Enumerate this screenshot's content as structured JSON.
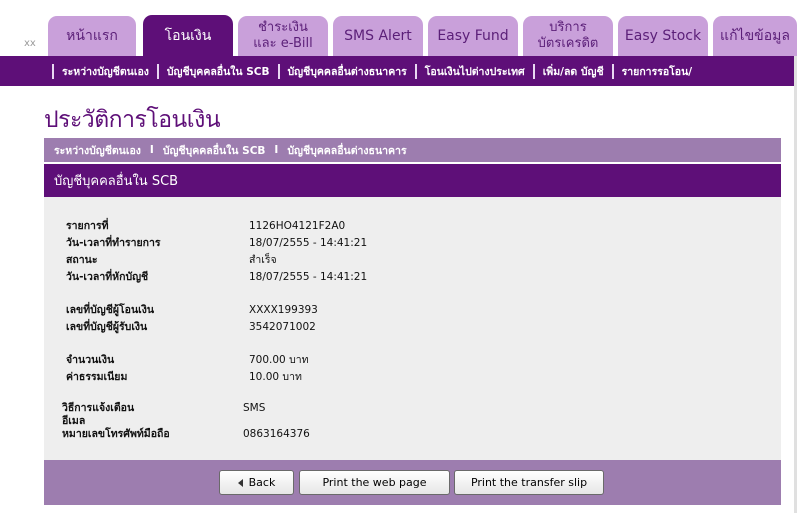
{
  "header": {
    "corner_text": "xx",
    "tabs": [
      {
        "label": "หน้าแรก"
      },
      {
        "label": "โอนเงิน"
      },
      {
        "label_line1": "ชำระเงิน",
        "label_line2": "และ e-Bill"
      },
      {
        "label": "SMS Alert"
      },
      {
        "label": "Easy Fund"
      },
      {
        "label_line1": "บริการ",
        "label_line2": "บัตรเครดิต"
      },
      {
        "label": "Easy Stock"
      },
      {
        "label": "แก้ไขข้อมูล"
      }
    ]
  },
  "subnav": {
    "items": [
      "ระหว่างบัญชีตนเอง",
      "บัญชีบุคคลอื่นใน SCB",
      "บัญชีบุคคลอื่นต่างธนาคาร",
      "โอนเงินไปต่างประเทศ",
      "เพิ่ม/ลด บัญชี",
      "รายการรอโอน/"
    ]
  },
  "page": {
    "title": "ประวัติการโอนเงิน"
  },
  "breadcrumb": {
    "items": [
      "ระหว่างบัญชีตนเอง",
      "บัญชีบุคคลอื่นใน SCB",
      "บัญชีบุคคลอื่นต่างธนาคาร"
    ],
    "separator": "I"
  },
  "section": {
    "title": "บัญชีบุคคลอื่นใน SCB"
  },
  "details": {
    "txn_id_label": "รายการที่",
    "txn_id_value": "1126HO4121F2A0",
    "txn_datetime_label": "วัน-เวลาที่ทำรายการ",
    "txn_datetime_value": "18/07/2555 - 14:41:21",
    "status_label": "สถานะ",
    "status_value": "สำเร็จ",
    "debit_datetime_label": "วัน-เวลาที่หักบัญชี",
    "debit_datetime_value": "18/07/2555 - 14:41:21",
    "from_account_label": "เลขที่บัญชีผู้โอนเงิน",
    "from_account_value": "XXXX199393",
    "to_account_label": "เลขที่บัญชีผู้รับเงิน",
    "to_account_value": "3542071002",
    "amount_label": "จำนวนเงิน",
    "amount_value": "700.00",
    "amount_unit": "บาท",
    "fee_label": "ค่าธรรมเนียม",
    "fee_value": "10.00",
    "fee_unit": "บาท",
    "notify_method_label": "วิธีการแจ้งเตือน",
    "notify_method_value": "SMS",
    "email_label": "อีเมล",
    "phone_label": "หมายเลขโทรศัพท์มือถือ",
    "phone_value": "0863164376"
  },
  "buttons": {
    "back": "Back",
    "print_page": "Print the web page",
    "print_slip": "Print the transfer slip"
  },
  "colors": {
    "primary_purple": "#5e0f78",
    "tab_inactive": "#c9a0da",
    "bar_purple": "#9d7daf",
    "panel_gray": "#eeeeee"
  }
}
